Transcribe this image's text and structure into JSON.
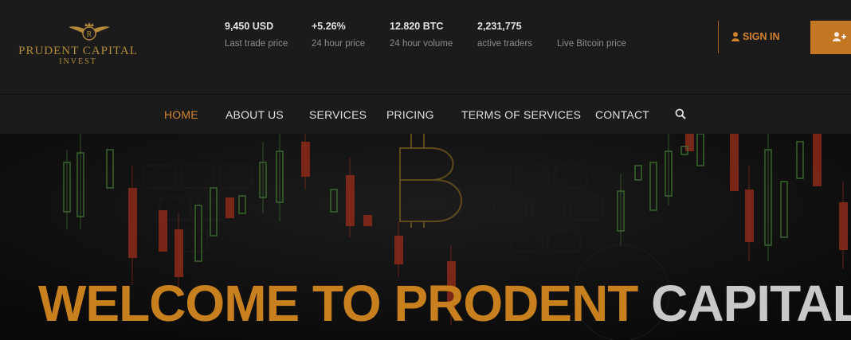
{
  "brand": {
    "name": "PRUDENT CAPITAL",
    "sub": "INVEST",
    "emblem_letter": "R"
  },
  "stats": [
    {
      "value": "9,450 USD",
      "label": "Last trade price"
    },
    {
      "value": "+5.26%",
      "label": "24 hour price"
    },
    {
      "value": "12.820 BTC",
      "label": "24 hour volume"
    },
    {
      "value": "2,231,775",
      "label": "active traders"
    },
    {
      "value": "",
      "label": "Live Bitcoin price"
    }
  ],
  "auth": {
    "signin_label": "SIGN IN"
  },
  "nav": {
    "items": [
      "HOME",
      "ABOUT US",
      "SERVICES",
      "PRICING",
      "TERMS OF SERVICES",
      "CONTACT"
    ]
  },
  "hero": {
    "title_gold": "WELCOME TO PRODENT",
    "title_gray": "CAPITAL"
  },
  "colors": {
    "accent": "#c47722",
    "gold": "#b38a3a",
    "bull": "#4a7a3a",
    "bear": "#9b3220"
  },
  "icons": [
    "user-icon",
    "user-plus-icon",
    "search-icon",
    "bitcoin-icon",
    "crown-wings-emblem"
  ]
}
